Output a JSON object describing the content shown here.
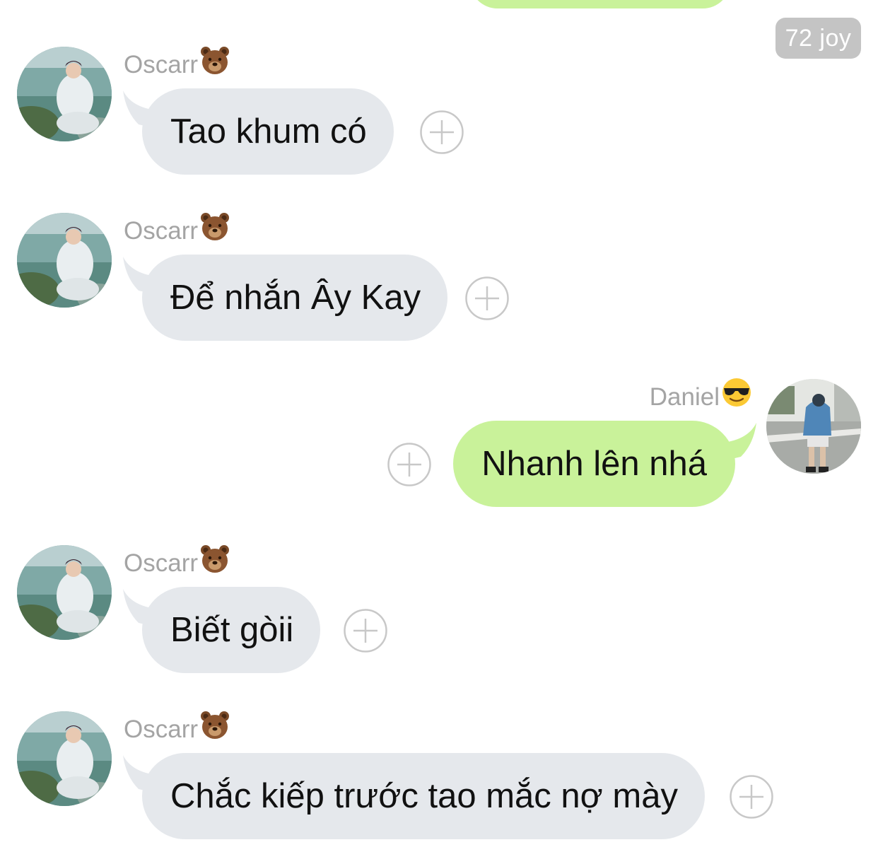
{
  "badge": {
    "text": "72 joy"
  },
  "messages": [
    {
      "sender": "Oscarr",
      "sender_emoji": "bear-face-icon",
      "text": "Tao khum có",
      "direction": "incoming"
    },
    {
      "sender": "Oscarr",
      "sender_emoji": "bear-face-icon",
      "text": "Để nhắn Ây Kay",
      "direction": "incoming"
    },
    {
      "sender": "Daniel",
      "sender_emoji": "sunglasses-face-icon",
      "text": "Nhanh lên nhá",
      "direction": "outgoing"
    },
    {
      "sender": "Oscarr",
      "sender_emoji": "bear-face-icon",
      "text": "Biết gòii",
      "direction": "incoming"
    },
    {
      "sender": "Oscarr",
      "sender_emoji": "bear-face-icon",
      "text": "Chắc kiếp trước tao mắc nợ mày",
      "direction": "incoming"
    }
  ],
  "colors": {
    "incoming_bubble": "#e5e8ec",
    "outgoing_bubble": "#c9f29a",
    "sender_name": "#a4a4a4",
    "badge_bg": "#c4c4c4",
    "plus_icon": "#c8c8c8"
  }
}
